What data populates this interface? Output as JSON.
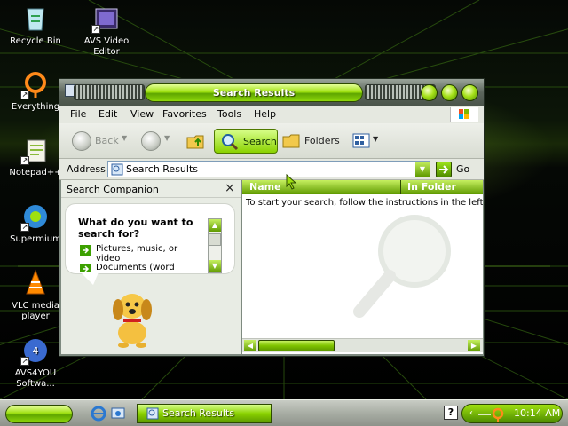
{
  "desktop": {
    "icons": [
      {
        "label": "Recycle Bin",
        "icon": "recycle-bin-icon"
      },
      {
        "label": "AVS Video Editor",
        "icon": "avs-video-editor-icon"
      },
      {
        "label": "Everything",
        "icon": "everything-search-icon"
      },
      {
        "label": "Notepad++",
        "icon": "notepadpp-icon"
      },
      {
        "label": "Supermium",
        "icon": "supermium-browser-icon"
      },
      {
        "label": "VLC media player",
        "icon": "vlc-cone-icon"
      },
      {
        "label": "AVS4YOU Softwa...",
        "icon": "avs4you-icon"
      }
    ]
  },
  "window": {
    "title": "Search Results",
    "menu": [
      "File",
      "Edit",
      "View",
      "Favorites",
      "Tools",
      "Help"
    ],
    "toolbar": {
      "back": "Back",
      "search": "Search",
      "folders": "Folders"
    },
    "address": {
      "label": "Address",
      "value": "Search Results",
      "go": "Go"
    },
    "companion": {
      "title": "Search Companion",
      "close": "×",
      "question": "What do you want to search for?",
      "options": [
        "Pictures, music, or video",
        "Documents (word"
      ]
    },
    "results": {
      "columns": [
        "Name",
        "In Folder"
      ],
      "message": "To start your search, follow the instructions in the left p"
    }
  },
  "taskbar": {
    "task": "Search Results",
    "clock": "10:14 AM",
    "help": "?"
  },
  "colors": {
    "accent": "#8ad200",
    "accent_dark": "#4e8c00"
  }
}
